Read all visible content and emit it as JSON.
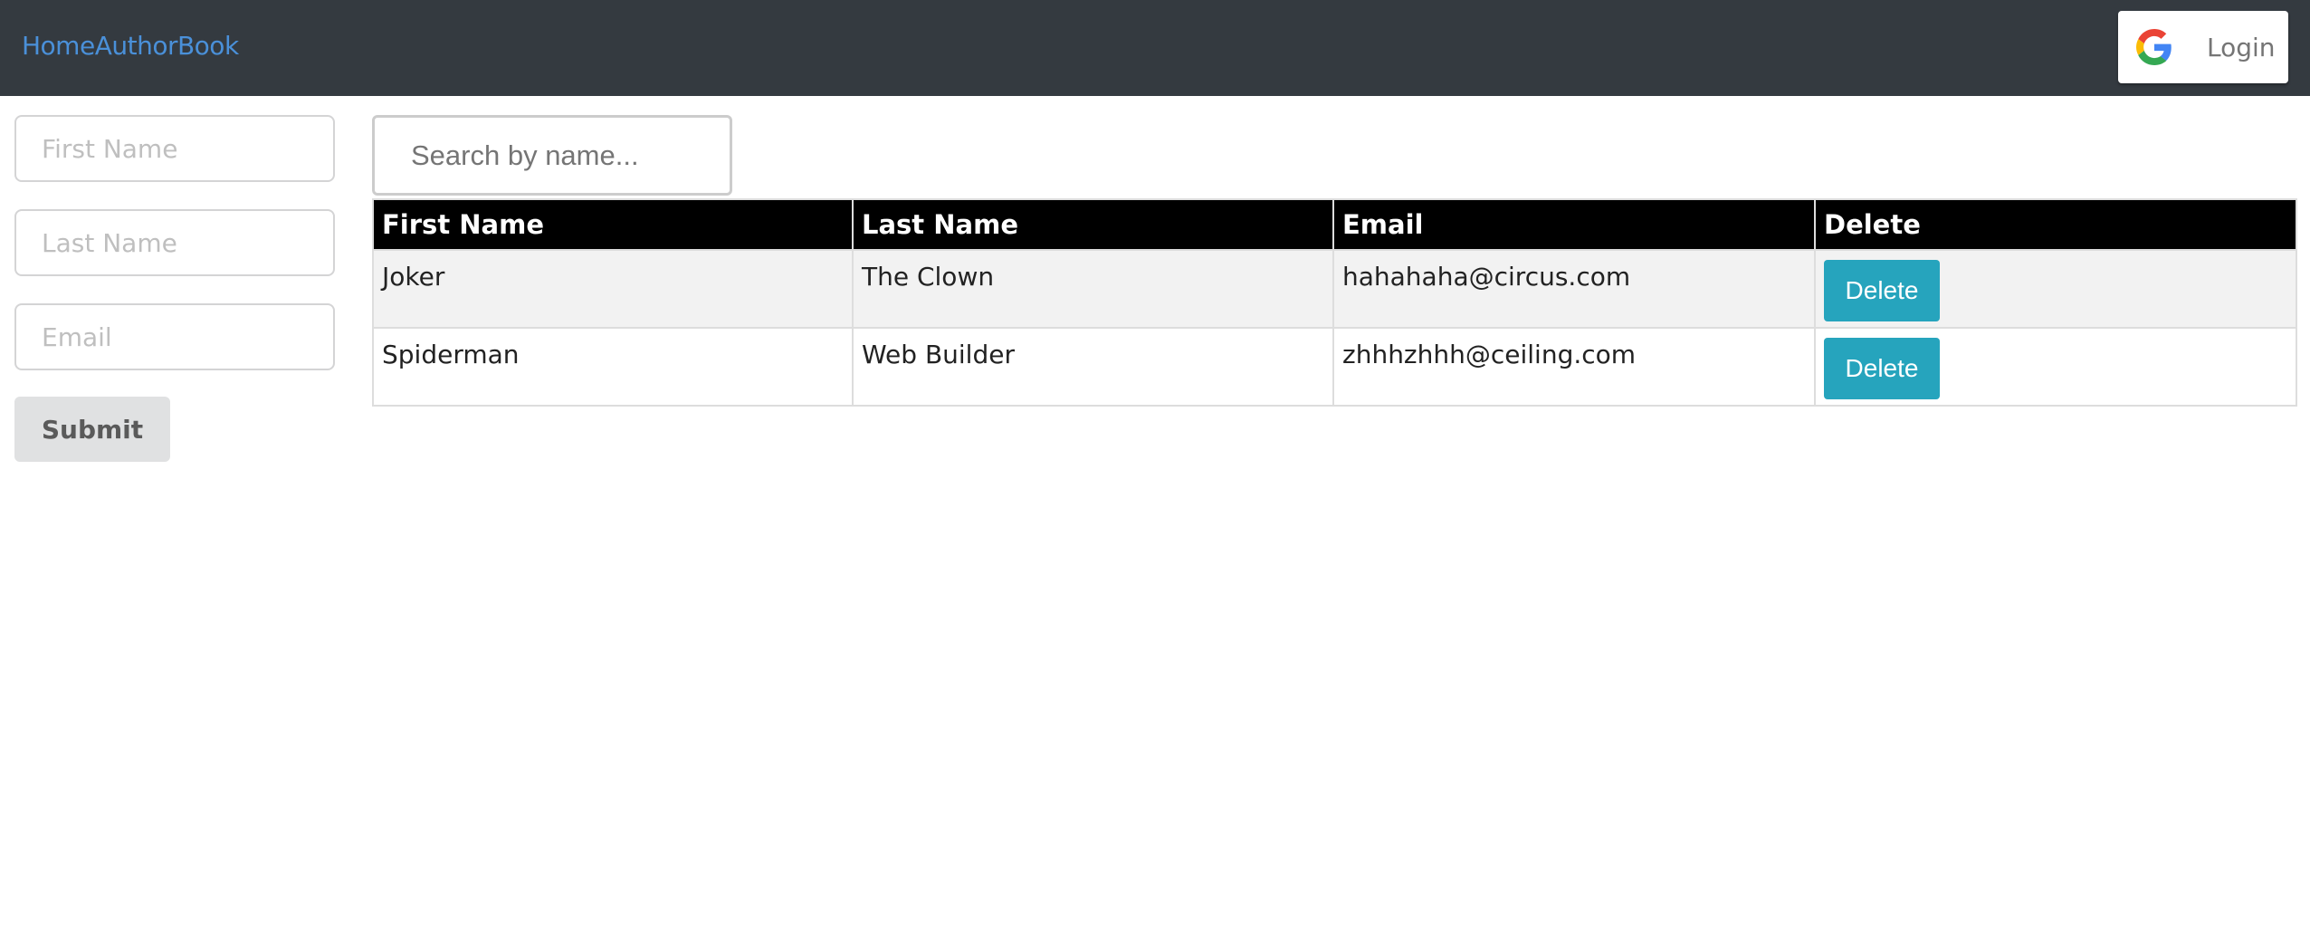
{
  "navbar": {
    "links": [
      "Home",
      "Author",
      "Book"
    ],
    "login_label": "Login",
    "background": "#343a40",
    "link_color": "#4a90d9"
  },
  "form": {
    "first_name_placeholder": "First Name",
    "last_name_placeholder": "Last Name",
    "email_placeholder": "Email",
    "submit_label": "Submit"
  },
  "search": {
    "placeholder": "Search by name..."
  },
  "table": {
    "headers": [
      "First Name",
      "Last Name",
      "Email",
      "Delete"
    ],
    "rows": [
      {
        "first_name": "Joker",
        "last_name": "The Clown",
        "email": "hahahaha@circus.com",
        "action": "Delete"
      },
      {
        "first_name": "Spiderman",
        "last_name": "Web Builder",
        "email": "zhhhzhhh@ceiling.com",
        "action": "Delete"
      }
    ],
    "delete_button_color": "#26a4bd"
  }
}
